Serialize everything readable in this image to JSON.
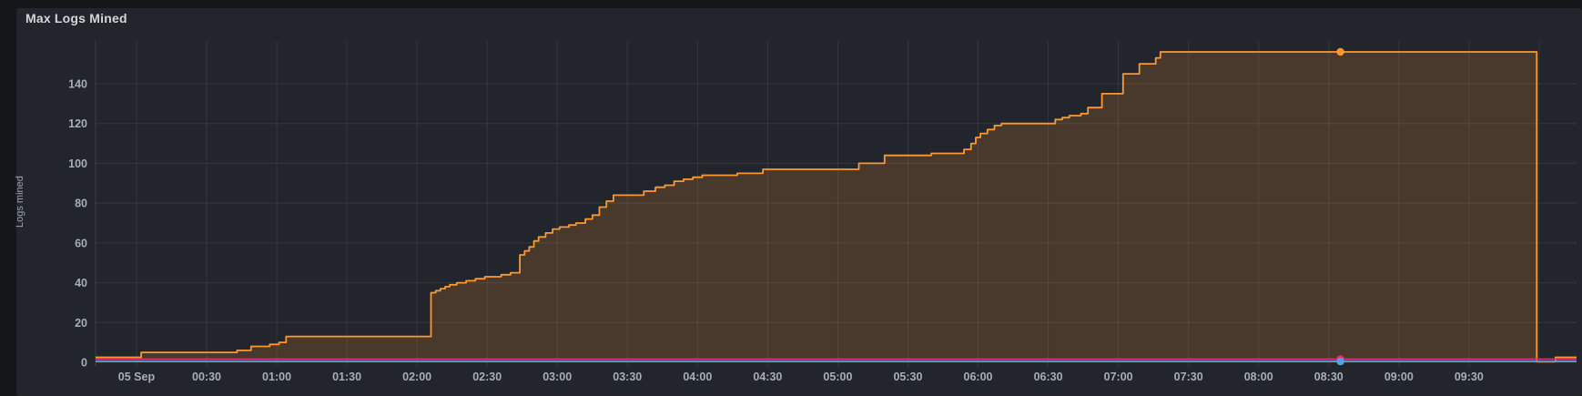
{
  "panel": {
    "title": "Max Logs Mined"
  },
  "chart_data": {
    "type": "line",
    "subtype": "stepped-area-time-series",
    "title": "Max Logs Mined",
    "xlabel": "",
    "ylabel": "Logs mined",
    "legend_position": "none",
    "grid": true,
    "background_color": "#22252b",
    "grid_color": "rgba(255,255,255,0.08)",
    "axis_color": "rgba(255,255,255,0.12)",
    "x_tick_labels": [
      "05 Sep",
      "00:30",
      "01:00",
      "01:30",
      "02:00",
      "02:30",
      "03:00",
      "03:30",
      "04:00",
      "04:30",
      "05:00",
      "05:30",
      "06:00",
      "06:30",
      "07:00",
      "07:30",
      "08:00",
      "08:30",
      "09:00",
      "09:30"
    ],
    "x_tick_minutes": [
      0,
      30,
      60,
      90,
      120,
      150,
      180,
      210,
      240,
      270,
      300,
      330,
      360,
      390,
      420,
      450,
      480,
      510,
      540,
      570
    ],
    "x_extra_grid_minutes": [
      600
    ],
    "x_range_minutes": [
      -17.5,
      616
    ],
    "y_ticks": [
      0,
      20,
      40,
      60,
      80,
      100,
      120,
      140
    ],
    "y_range": [
      0,
      161
    ],
    "series": [
      {
        "id": "series-1-max-logs-mined",
        "color": "#ff9830",
        "fill": "rgba(255,152,48,0.18)",
        "step": true,
        "points": [
          [
            -17.5,
            2.5
          ],
          [
            2,
            5
          ],
          [
            43,
            6
          ],
          [
            49,
            8
          ],
          [
            57,
            9
          ],
          [
            61,
            10
          ],
          [
            64,
            13
          ],
          [
            126,
            35
          ],
          [
            128,
            36
          ],
          [
            130,
            37
          ],
          [
            132,
            38
          ],
          [
            134,
            39
          ],
          [
            137,
            40
          ],
          [
            141,
            41
          ],
          [
            145,
            42
          ],
          [
            149,
            43
          ],
          [
            156,
            44
          ],
          [
            160,
            45
          ],
          [
            164,
            54
          ],
          [
            166,
            56
          ],
          [
            168,
            58
          ],
          [
            170,
            61
          ],
          [
            172,
            63
          ],
          [
            175,
            65
          ],
          [
            178,
            67
          ],
          [
            181,
            68
          ],
          [
            185,
            69
          ],
          [
            188,
            70
          ],
          [
            192,
            72
          ],
          [
            195,
            74
          ],
          [
            198,
            78
          ],
          [
            201,
            81
          ],
          [
            204,
            84
          ],
          [
            217,
            86
          ],
          [
            222,
            88
          ],
          [
            226,
            89
          ],
          [
            230,
            91
          ],
          [
            234,
            92
          ],
          [
            238,
            93
          ],
          [
            242,
            94
          ],
          [
            257,
            95
          ],
          [
            268,
            97
          ],
          [
            309,
            100
          ],
          [
            320,
            104
          ],
          [
            340,
            105
          ],
          [
            354,
            107
          ],
          [
            357,
            110
          ],
          [
            359,
            113
          ],
          [
            361,
            115
          ],
          [
            364,
            117
          ],
          [
            367,
            119
          ],
          [
            370,
            120
          ],
          [
            393,
            122
          ],
          [
            396,
            123
          ],
          [
            399,
            124
          ],
          [
            404,
            125
          ],
          [
            407,
            128
          ],
          [
            413,
            135
          ],
          [
            422,
            145
          ],
          [
            429,
            150
          ],
          [
            436,
            153
          ],
          [
            438,
            156
          ],
          [
            599,
            0.3
          ],
          [
            607,
            2.5
          ]
        ],
        "marker": {
          "t": 515,
          "v": 156
        }
      },
      {
        "id": "series-2",
        "color": "#e02f7a",
        "fill": null,
        "step": true,
        "points": [
          [
            -17.5,
            1.6
          ],
          [
            616,
            1.6
          ]
        ],
        "marker": {
          "t": 515,
          "v": 1.6
        }
      },
      {
        "id": "series-3",
        "color": "#4aa5e0",
        "fill": null,
        "step": true,
        "points": [
          [
            -17.5,
            0.4
          ],
          [
            616,
            0.4
          ]
        ],
        "marker": {
          "t": 515,
          "v": 0.4
        }
      }
    ]
  }
}
